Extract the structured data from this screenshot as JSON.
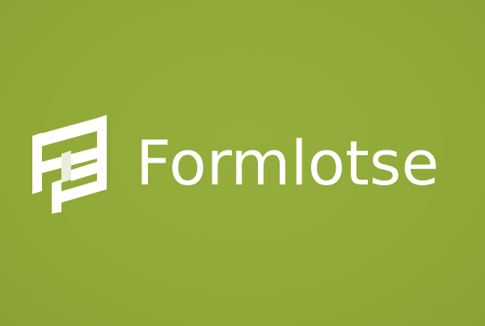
{
  "brand": {
    "name": "Formlotse",
    "text_color": "#ffffff",
    "background_color": "#92aa38",
    "logo_icon": "interlocking-f-mark-icon"
  }
}
